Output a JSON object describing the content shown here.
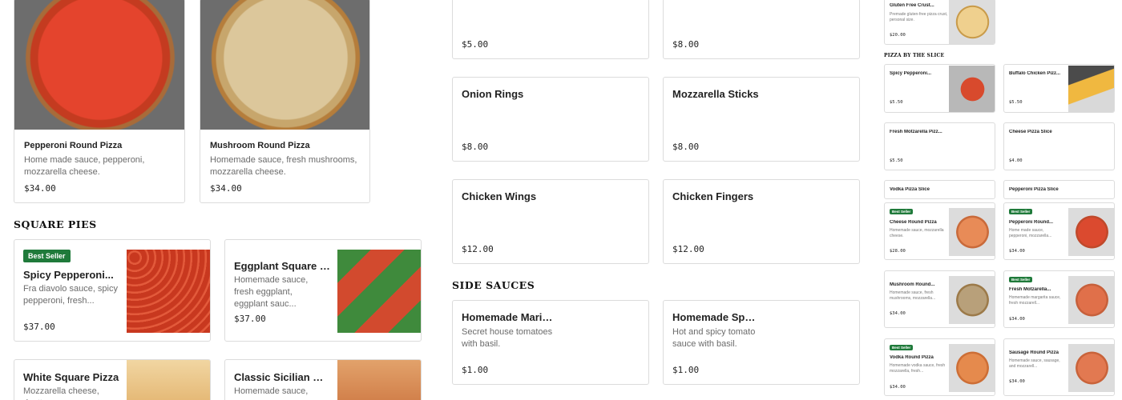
{
  "round_pies": [
    {
      "name": "Pepperoni Round Pizza",
      "desc": "Home made sauce, pepperoni, mozzarella cheese.",
      "price": "$34.00"
    },
    {
      "name": "Mushroom Round Pizza",
      "desc": "Homemade sauce, fresh mushrooms, mozzarella cheese.",
      "price": "$34.00"
    }
  ],
  "square_pies": {
    "title": "SQUARE PIES",
    "items": [
      {
        "badge": "Best Seller",
        "name": "Spicy Pepperoni...",
        "desc": "Fra diavolo sauce, spicy pepperoni, fresh...",
        "price": "$37.00"
      },
      {
        "name": "Eggplant Square Pizza",
        "desc": "Homemade sauce, fresh eggplant, eggplant sauc...",
        "price": "$37.00"
      },
      {
        "name": "White Square Pizza",
        "desc": "Mozzarella cheese, ricotta"
      },
      {
        "name": "Classic Sicilian Squ...",
        "desc": "Homemade sauce,"
      }
    ]
  },
  "appetizers": [
    {
      "price": "$5.00"
    },
    {
      "price": "$8.00"
    },
    {
      "name": "Onion Rings",
      "price": "$8.00"
    },
    {
      "name": "Mozzarella Sticks",
      "price": "$8.00"
    },
    {
      "name": "Chicken Wings",
      "price": "$12.00"
    },
    {
      "name": "Chicken Fingers",
      "price": "$12.00"
    }
  ],
  "side_sauces": {
    "title": "SIDE SAUCES",
    "items": [
      {
        "name": "Homemade Marinar...",
        "desc": "Secret house tomatoes with basil.",
        "price": "$1.00"
      },
      {
        "name": "Homemade Spicy...",
        "desc": "Hot and spicy tomato sauce with basil.",
        "price": "$1.00"
      }
    ]
  },
  "preview": {
    "gluten_free": {
      "name": "Gluten Free Crust...",
      "desc": "Premade gluten-free pizza crust, personal size.",
      "price": "$20.00"
    },
    "slice_title": "PIZZA BY THE SLICE",
    "slices": [
      {
        "name": "Spicy Pepperoni...",
        "price": "$5.50"
      },
      {
        "name": "Buffalo Chicken Pizz...",
        "price": "$5.50"
      },
      {
        "name": "Fresh Motzarella Pizz...",
        "price": "$5.50"
      },
      {
        "name": "Cheese Pizza Slice",
        "price": "$4.00"
      },
      {
        "name": "Vodka Pizza Slice"
      },
      {
        "name": "Pepperoni Pizza Slice"
      }
    ],
    "rounds": [
      {
        "badge": "Best Seller",
        "name": "Cheese Round Pizza",
        "desc": "Homemade sauce, mozzarella cheese.",
        "price": "$28.00"
      },
      {
        "badge": "Best Seller",
        "name": "Pepperoni Round...",
        "desc": "Home made sauce, pepperoni, mozzarella...",
        "price": "$34.00"
      },
      {
        "name": "Mushroom Round...",
        "desc": "Homemade sauce, fresh mushrooms, mozzarella...",
        "price": "$34.00"
      },
      {
        "badge": "Best Seller",
        "name": "Fresh Motzarella...",
        "desc": "Homemade margarita sauce, fresh mozzarell...",
        "price": "$34.00"
      },
      {
        "badge": "Best Seller",
        "name": "Vodka Round Pizza",
        "desc": "Homemade vodka sauce, fresh mozzarella, fresh...",
        "price": "$34.00"
      },
      {
        "name": "Sausage Round Pizza",
        "desc": "Homemade sauce, sausage, and mozzarell...",
        "price": "$34.00"
      }
    ]
  }
}
